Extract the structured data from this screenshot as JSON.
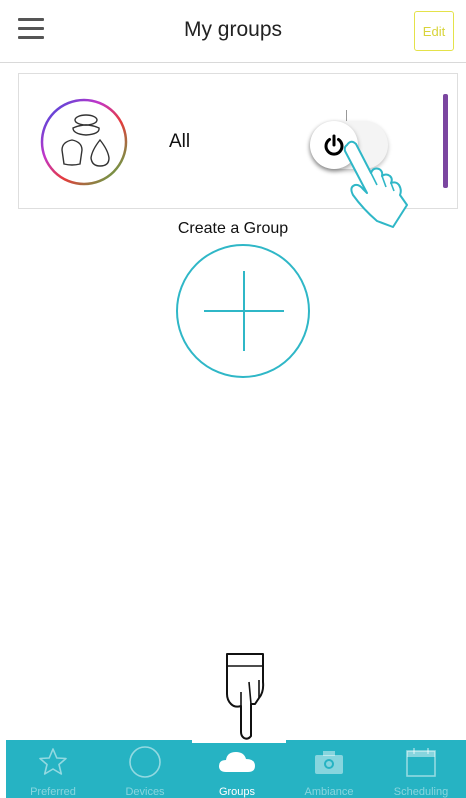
{
  "header": {
    "title": "My groups",
    "edit_label": "Edit",
    "menu_icon": "menu-icon"
  },
  "groups": [
    {
      "name": "All",
      "power_on": true,
      "avatar_icon": "all-lamps-icon",
      "accent_color": "#7b46a0"
    }
  ],
  "create": {
    "label": "Create a Group",
    "icon": "plus-icon"
  },
  "tabbar": {
    "background": "#26b3c3",
    "items": [
      {
        "label": "Preferred",
        "icon": "star-icon",
        "active": false
      },
      {
        "label": "Devices",
        "icon": "circle-icon",
        "active": false
      },
      {
        "label": "Groups",
        "icon": "cloud-icon",
        "active": true
      },
      {
        "label": "Ambiance",
        "icon": "camera-icon",
        "active": false
      },
      {
        "label": "Scheduling",
        "icon": "calendar-icon",
        "active": false
      }
    ]
  }
}
